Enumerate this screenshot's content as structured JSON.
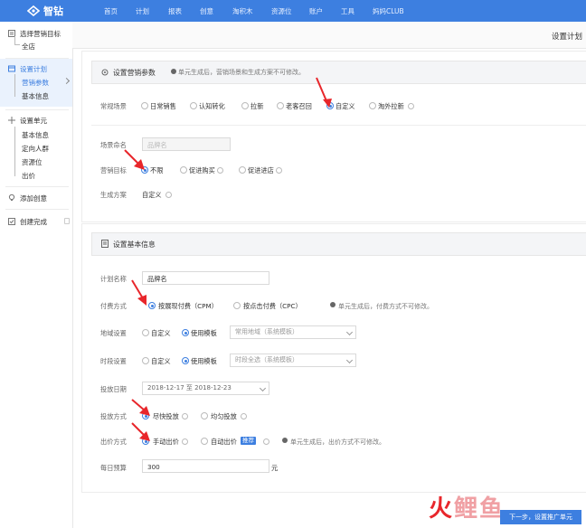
{
  "brand": {
    "name": "智钻",
    "accent": "#3d7fe0",
    "arrow_color": "#e8262b"
  },
  "nav": {
    "items": [
      "首页",
      "计划",
      "报表",
      "创意",
      "淘积木",
      "资源位",
      "账户",
      "工具",
      "妈妈CLUB"
    ]
  },
  "page_title": "设置计划",
  "sidebar": {
    "step1_title": "选择营销目标",
    "step1_sub": "全店",
    "step2_title": "设置计划",
    "step2_subs": [
      "营销参数",
      "基本信息"
    ],
    "step3_title": "设置单元",
    "step3_subs": [
      "基本信息",
      "定向人群",
      "资源位",
      "出价"
    ],
    "step4_title": "添加创意",
    "step5_title": "创建完成"
  },
  "section1": {
    "title": "设置营销参数",
    "note": "单元生成后，营销场景和生成方案不可修改。",
    "scene_label": "常规场景",
    "scene_options": [
      "日常销售",
      "认知转化",
      "拉新",
      "老客召回",
      "自定义",
      "淘外拉新"
    ],
    "scene_name_label": "场景命名",
    "scene_name_placeholder": "品牌名",
    "goal_label": "营销目标",
    "goal_options": [
      "不限",
      "促进购买",
      "促进进店"
    ],
    "gen_label": "生成方案",
    "gen_value": "自定义"
  },
  "section2": {
    "title": "设置基本信息",
    "plan_name_label": "计划名称",
    "plan_name_value": "品牌名",
    "pay_label": "付费方式",
    "pay_options": [
      "按展现付费（CPM）",
      "按点击付费（CPC）"
    ],
    "pay_note": "单元生成后，付费方式不可修改。",
    "region_label": "地域设置",
    "region_options": [
      "自定义",
      "使用模板"
    ],
    "region_select": "常用地域（系统模板）",
    "time_label": "时段设置",
    "time_options": [
      "自定义",
      "使用模板"
    ],
    "time_select": "时段全选（系统模板）",
    "date_label": "投放日期",
    "date_start": "2018-12-17",
    "date_sep": "至",
    "date_end": "2018-12-23",
    "deliver_label": "投放方式",
    "deliver_options": [
      "尽快投放",
      "均匀投放"
    ],
    "bid_label": "出价方式",
    "bid_options": [
      "手动出价",
      "自动出价"
    ],
    "bid_badge": "推荐",
    "bid_note": "单元生成后，出价方式不可修改。",
    "budget_label": "每日预算",
    "budget_value": "300",
    "budget_unit": "元"
  },
  "footer": {
    "next_button": "下一步，设置推广单元"
  },
  "watermark": {
    "text_left": "火",
    "text_right": "鲤鱼"
  }
}
